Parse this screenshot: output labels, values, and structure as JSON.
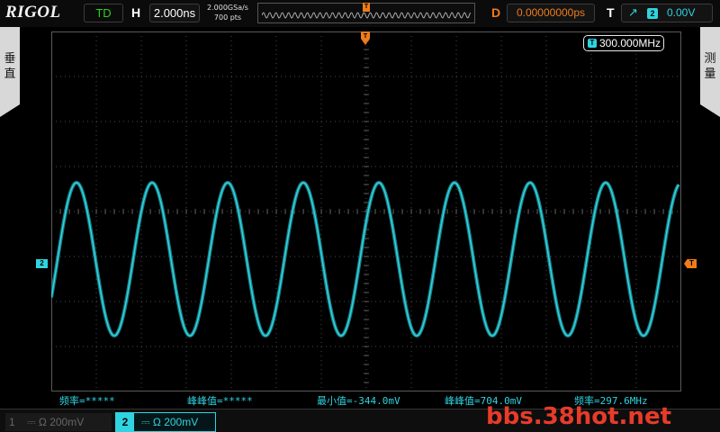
{
  "topbar": {
    "brand": "RIGOL",
    "run_state": "TD",
    "horizontal_label": "H",
    "timebase": "2.000ns",
    "sample_rate": "2.000GSa/s",
    "memory_depth": "700 pts",
    "delay_label": "D",
    "delay_value": "0.00000000ps",
    "trigger_label": "T",
    "trigger_source": "2",
    "trigger_level": "0.00V",
    "memory_marker": "T"
  },
  "side_tabs": {
    "left": [
      "垂",
      "直"
    ],
    "right": [
      "测",
      "量"
    ]
  },
  "screen": {
    "frequency_counter": "300.000MHz",
    "counter_tag": "T",
    "channel_marker": "2",
    "trigger_level_marker": "T",
    "trace_color": "#2fd4e0",
    "trigger_color": "#ef7b1b"
  },
  "measurements": [
    {
      "label": "频率=*****"
    },
    {
      "label": "峰峰值=*****"
    },
    {
      "label": "最小值=-344.0mV"
    },
    {
      "label": "峰峰值=704.0mV"
    },
    {
      "label": "频率=297.6MHz"
    }
  ],
  "bottombar": {
    "ch1_number": "1",
    "ch1_info": "⎓ Ω 200mV",
    "ch2_number": "2",
    "ch2_info": "⎓ Ω 200mV"
  },
  "watermark": "bbs.38hot.net"
}
